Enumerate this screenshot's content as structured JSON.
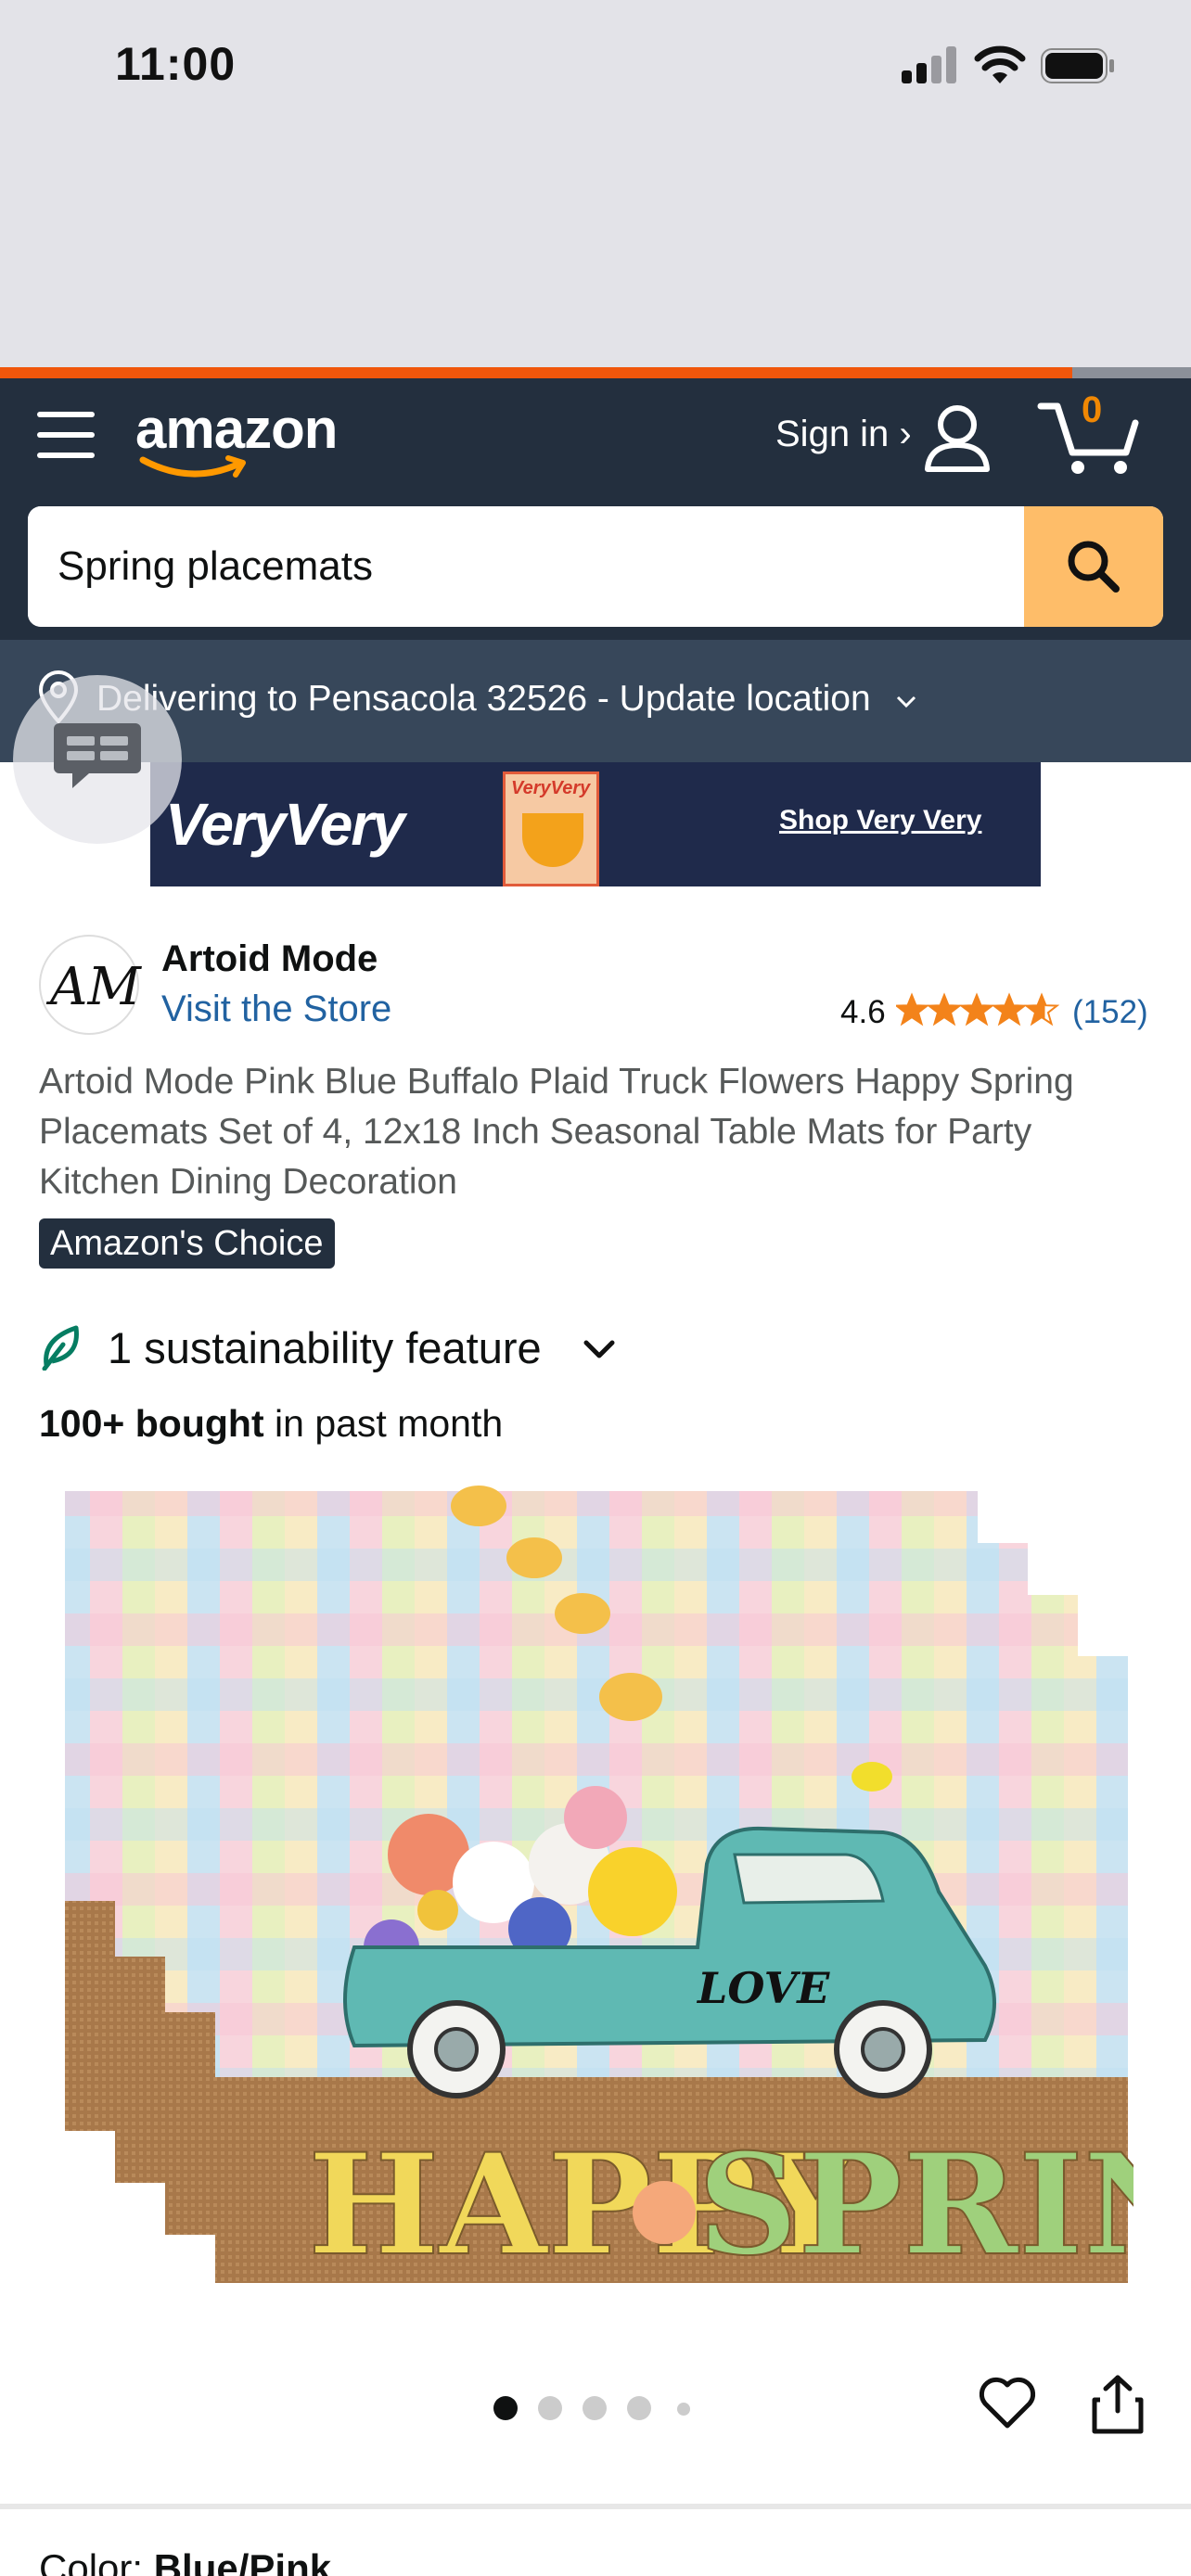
{
  "status": {
    "time": "11:00"
  },
  "page_load_progress": 0.9,
  "header": {
    "logo": "amazon",
    "signin_label": "Sign in ›",
    "cart_count": "0"
  },
  "search": {
    "value": "Spring placemats"
  },
  "delivery": {
    "text": "Delivering to Pensacola 32526 - Update location"
  },
  "banner": {
    "brand": "VeryVery",
    "product_label": "VeryVery",
    "cta": "Shop Very Very"
  },
  "store": {
    "name": "Artoid Mode",
    "visit_label": "Visit the Store",
    "logo_text": "AM"
  },
  "rating": {
    "value": "4.6",
    "stars": 4.6,
    "count": "(152)"
  },
  "product": {
    "title": "Artoid Mode Pink Blue Buffalo Plaid Truck Flowers Happy Spring Placemats Set of 4, 12x18 Inch Seasonal Table Mats for Party Kitchen Dining Decoration",
    "badge": "Amazon's Choice",
    "sustainability": "1 sustainability feature",
    "bought_bold": "100+ bought",
    "bought_rest": " in past month",
    "image_text": {
      "love": "LOVE",
      "happy": "HAPPY",
      "spring": "SPRING"
    }
  },
  "carousel": {
    "total": 5,
    "active": 1
  },
  "variant": {
    "label": "Color: ",
    "value": "Blue/Pink"
  },
  "colors": {
    "header": "#232f3e",
    "subheader": "#37475a",
    "accent": "#febd69",
    "link": "#2162a1",
    "star": "#f3831a"
  }
}
